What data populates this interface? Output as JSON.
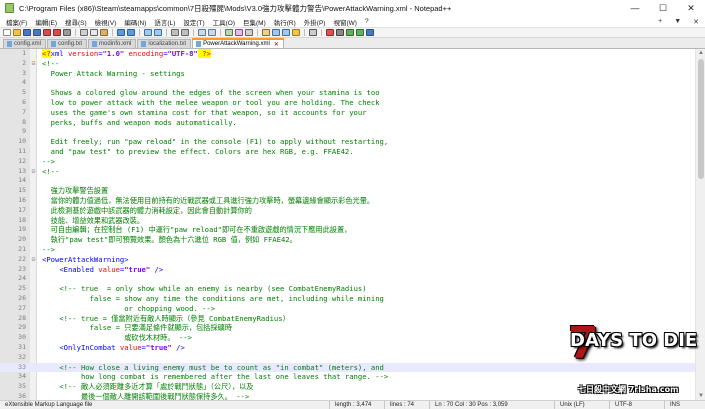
{
  "window": {
    "title": "C:\\Program Files (x86)\\Steam\\steamapps\\common\\7日殺殭屍\\Mods\\V3.0強力攻擊體力警告\\PowerAttackWarning.xml - Notepad++",
    "minimize_glyph": "—",
    "maximize_glyph": "☐",
    "close_glyph": "✕"
  },
  "menu": {
    "items": [
      "檔案(F)",
      "編輯(E)",
      "搜尋(S)",
      "檢視(V)",
      "編碼(N)",
      "語言(L)",
      "設定(T)",
      "工具(O)",
      "巨集(M)",
      "執行(R)",
      "外掛(P)",
      "視窗(W)",
      "?"
    ],
    "right_plus": "+",
    "right_arrow": "▼",
    "right_close": "✕"
  },
  "tabs": [
    {
      "label": "config.xml",
      "active": false
    },
    {
      "label": "config.txt",
      "active": false
    },
    {
      "label": "modinfo.xml",
      "active": false
    },
    {
      "label": "localization.txt",
      "active": false
    },
    {
      "label": "PowerAttackWarning.xml",
      "active": true
    }
  ],
  "tab_close_glyph": "✕",
  "editor": {
    "lines": [
      {
        "n": "1",
        "fold": "",
        "tokens": [
          {
            "c": "decl",
            "t": "<?"
          },
          {
            "c": "tag",
            "t": "xml"
          },
          {
            "c": "attr",
            "t": " version"
          },
          {
            "c": "sym",
            "t": "="
          },
          {
            "c": "val",
            "t": "\"1.0\""
          },
          {
            "c": "attr",
            "t": " encoding"
          },
          {
            "c": "sym",
            "t": "="
          },
          {
            "c": "val",
            "t": "\"UTF-8\""
          },
          {
            "c": "decl",
            "t": " ?>"
          }
        ]
      },
      {
        "n": "2",
        "fold": "⊟",
        "tokens": [
          {
            "c": "comment",
            "t": "<!--"
          }
        ]
      },
      {
        "n": "3",
        "fold": "",
        "tokens": [
          {
            "c": "comment",
            "t": "  Power Attack Warning - settings"
          }
        ]
      },
      {
        "n": "4",
        "fold": "",
        "tokens": [
          {
            "c": "comment",
            "t": ""
          }
        ]
      },
      {
        "n": "5",
        "fold": "",
        "tokens": [
          {
            "c": "comment",
            "t": "  Shows a colored glow around the edges of the screen when your stamina is too"
          }
        ]
      },
      {
        "n": "6",
        "fold": "",
        "tokens": [
          {
            "c": "comment",
            "t": "  low to power attack with the melee weapon or tool you are holding. The check"
          }
        ]
      },
      {
        "n": "7",
        "fold": "",
        "tokens": [
          {
            "c": "comment",
            "t": "  uses the game's own stamina cost for that weapon, so it accounts for your"
          }
        ]
      },
      {
        "n": "8",
        "fold": "",
        "tokens": [
          {
            "c": "comment",
            "t": "  perks, buffs and weapon mods automatically."
          }
        ]
      },
      {
        "n": "9",
        "fold": "",
        "tokens": [
          {
            "c": "comment",
            "t": ""
          }
        ]
      },
      {
        "n": "10",
        "fold": "",
        "tokens": [
          {
            "c": "comment",
            "t": "  Edit freely; run \"paw reload\" in the console (F1) to apply without restarting,"
          }
        ]
      },
      {
        "n": "11",
        "fold": "",
        "tokens": [
          {
            "c": "comment",
            "t": "  and \"paw test\" to preview the effect. Colors are hex RGB, e.g. FFAE42."
          }
        ]
      },
      {
        "n": "12",
        "fold": "",
        "tokens": [
          {
            "c": "comment",
            "t": "-->"
          }
        ]
      },
      {
        "n": "13",
        "fold": "⊟",
        "tokens": [
          {
            "c": "comment",
            "t": "<!--"
          }
        ]
      },
      {
        "n": "14",
        "fold": "",
        "tokens": [
          {
            "c": "comment",
            "t": ""
          }
        ]
      },
      {
        "n": "15",
        "fold": "",
        "tokens": [
          {
            "c": "comment",
            "t": "  強力攻擊警告設置"
          }
        ]
      },
      {
        "n": "16",
        "fold": "",
        "tokens": [
          {
            "c": "comment",
            "t": "  當你的體力值過低，無法使用目前持有的近戰武器或工具進行強力攻擊時，螢幕邊緣會顯示彩色光暈。"
          }
        ]
      },
      {
        "n": "17",
        "fold": "",
        "tokens": [
          {
            "c": "comment",
            "t": "  此檢測基於遊戲中該武器的體力消耗設定，因此會自動計算你的"
          }
        ]
      },
      {
        "n": "18",
        "fold": "",
        "tokens": [
          {
            "c": "comment",
            "t": "  技能、增益效果和武器改裝。"
          }
        ]
      },
      {
        "n": "19",
        "fold": "",
        "tokens": [
          {
            "c": "comment",
            "t": "  可自由編輯；在控制台 (F1) 中運行\"paw reload\"即可在不重啟遊戲的情況下應用此設置，"
          }
        ]
      },
      {
        "n": "20",
        "fold": "",
        "tokens": [
          {
            "c": "comment",
            "t": "  執行\"paw test\"即可預覽效果。顏色為十六進位 RGB 值，例如 FFAE42。"
          }
        ]
      },
      {
        "n": "21",
        "fold": "",
        "tokens": [
          {
            "c": "comment",
            "t": "-->"
          }
        ]
      },
      {
        "n": "22",
        "fold": "⊟",
        "tokens": [
          {
            "c": "tag",
            "t": "<PowerAttackWarning>"
          }
        ]
      },
      {
        "n": "23",
        "fold": "",
        "tokens": [
          {
            "c": "plain",
            "t": "    "
          },
          {
            "c": "tag",
            "t": "<Enabled"
          },
          {
            "c": "attr",
            "t": " value"
          },
          {
            "c": "sym",
            "t": "="
          },
          {
            "c": "val",
            "t": "\"true\""
          },
          {
            "c": "tag",
            "t": " />"
          }
        ]
      },
      {
        "n": "24",
        "fold": "",
        "tokens": [
          {
            "c": "plain",
            "t": ""
          }
        ]
      },
      {
        "n": "25",
        "fold": "",
        "tokens": [
          {
            "c": "plain",
            "t": "    "
          },
          {
            "c": "comment",
            "t": "<!-- true  = only show while an enemy is nearby (see CombatEnemyRadius)"
          }
        ]
      },
      {
        "n": "26",
        "fold": "",
        "tokens": [
          {
            "c": "comment",
            "t": "           false = show any time the conditions are met, including while mining"
          }
        ]
      },
      {
        "n": "27",
        "fold": "",
        "tokens": [
          {
            "c": "comment",
            "t": "                   or chopping wood. -->"
          }
        ]
      },
      {
        "n": "28",
        "fold": "",
        "tokens": [
          {
            "c": "plain",
            "t": "    "
          },
          {
            "c": "comment",
            "t": "<!-- true = 僅當附近有敵人時顯示（參見 CombatEnemyRadius）"
          }
        ]
      },
      {
        "n": "29",
        "fold": "",
        "tokens": [
          {
            "c": "comment",
            "t": "           false = 只要滿足條件就顯示，包括採礦時"
          }
        ]
      },
      {
        "n": "30",
        "fold": "",
        "tokens": [
          {
            "c": "comment",
            "t": "                   或砍伐木材時。 -->"
          }
        ]
      },
      {
        "n": "31",
        "fold": "",
        "tokens": [
          {
            "c": "plain",
            "t": "    "
          },
          {
            "c": "tag",
            "t": "<OnlyInCombat"
          },
          {
            "c": "attr",
            "t": " value"
          },
          {
            "c": "sym",
            "t": "="
          },
          {
            "c": "val",
            "t": "\"true\""
          },
          {
            "c": "tag",
            "t": " />"
          }
        ]
      },
      {
        "n": "32",
        "fold": "",
        "tokens": [
          {
            "c": "plain",
            "t": ""
          }
        ]
      },
      {
        "n": "33",
        "fold": "",
        "tokens": [
          {
            "c": "plain",
            "t": "    "
          },
          {
            "c": "comment",
            "t": "<!-- How close a living enemy must be to count as \"in combat\" (meters), and"
          }
        ]
      },
      {
        "n": "34",
        "fold": "",
        "tokens": [
          {
            "c": "comment",
            "t": "         how long combat is remembered after the last one leaves that range. -->"
          }
        ]
      },
      {
        "n": "35",
        "fold": "",
        "tokens": [
          {
            "c": "plain",
            "t": "    "
          },
          {
            "c": "comment",
            "t": "<!-- 敵人必須距離多近才算「處於戰鬥狀態」（公尺），以及"
          }
        ]
      },
      {
        "n": "36",
        "fold": "",
        "tokens": [
          {
            "c": "comment",
            "t": "         最後一個敵人離開該範圍後戰鬥狀態保持多久。 -->"
          }
        ]
      }
    ],
    "current_line": "33"
  },
  "watermark": {
    "seven": "7",
    "main": "DAYS TO DIE",
    "sub": "七日殺中文網 7rlsha.com"
  },
  "statusbar": {
    "type": "eXtensible Markup Language file",
    "length": "length : 3,474",
    "lines": "lines : 74",
    "position": "Ln : 70    Col : 30    Pos : 3,059",
    "eol": "Unix (LF)",
    "encoding": "UTF-8",
    "mode": "INS"
  },
  "colors": {
    "comment": "#008000",
    "tag": "#0000ff",
    "attr": "#ff0000",
    "value": "#8000ff",
    "active_tab_accent": "#f79a26",
    "gutter": "#e4e4e4"
  }
}
